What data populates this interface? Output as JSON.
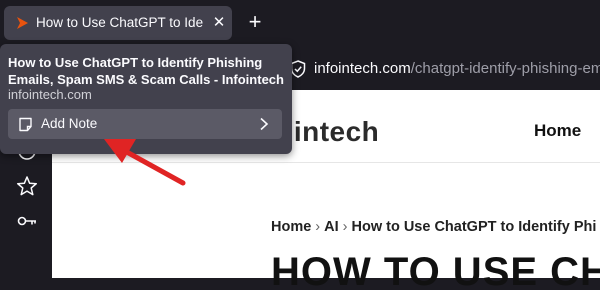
{
  "tab": {
    "title": "How to Use ChatGPT to Identify",
    "close": "✕",
    "new_tab": "+"
  },
  "urlbar": {
    "domain": "infointech.com",
    "path": "/chatgpt-identify-phishing-em"
  },
  "popup": {
    "title": "How to Use ChatGPT to Identify Phishing Emails, Spam SMS & Scam Calls - Infointech",
    "domain": "infointech.com",
    "add_note": "Add Note"
  },
  "page": {
    "logo_accent": "·",
    "logo_text": "intech",
    "nav_home": "Home",
    "breadcrumb": [
      "Home",
      "AI",
      "How to Use ChatGPT to Identify Phi"
    ],
    "breadcrumb_sep": "›",
    "headline": "HOW TO USE CH"
  },
  "colors": {
    "chrome_bg": "#1c1b22",
    "tab_bg": "#42414d",
    "accent_orange": "#e8530e",
    "arrow_red": "#e02424"
  },
  "icons": {
    "favicon": "infointech-favicon",
    "shield": "shield-check-icon",
    "note": "note-icon",
    "chevron": "chevron-right-icon",
    "sidebar": [
      "sidebar-item-icon",
      "star-icon",
      "key-icon"
    ]
  }
}
